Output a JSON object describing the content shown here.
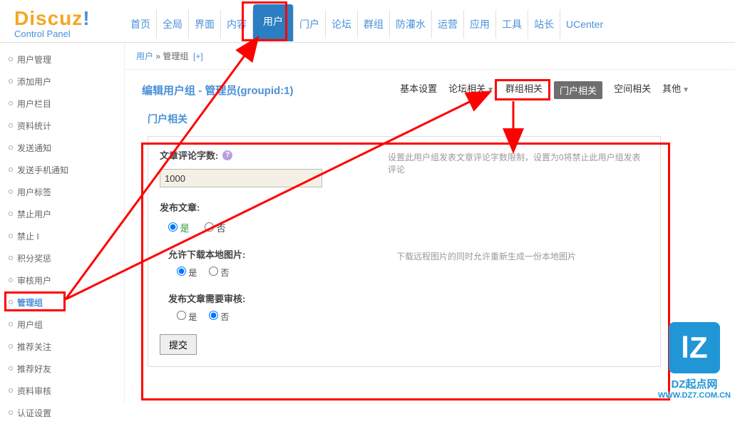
{
  "logo": {
    "main": "Discuz",
    "excl": "!",
    "sub": "Control Panel"
  },
  "topnav": [
    "首页",
    "全局",
    "界面",
    "内容",
    "用户",
    "门户",
    "论坛",
    "群组",
    "防灌水",
    "运营",
    "应用",
    "工具",
    "站长",
    "UCenter"
  ],
  "topnav_active": 4,
  "breadcrumb": {
    "a": "用户",
    "sep": " » ",
    "b": "管理组",
    "plus": "[+]"
  },
  "sidebar": {
    "items": [
      "用户管理",
      "添加用户",
      "用户栏目",
      "资料统计",
      "发送通知",
      "发送手机通知",
      "用户标签",
      "禁止用户",
      "禁止 I",
      "积分奖惩",
      "审核用户",
      "管理组",
      "用户组",
      "推荐关注",
      "推荐好友",
      "资料审核",
      "认证设置"
    ],
    "active": 11
  },
  "page_title": "编辑用户组 - 管理员(groupid:1)",
  "tabs": [
    {
      "label": "基本设置",
      "dd": false
    },
    {
      "label": "论坛相关",
      "dd": true
    },
    {
      "label": "群组相关",
      "dd": false
    },
    {
      "label": "门户相关",
      "dd": false,
      "active": true
    },
    {
      "label": "空间相关",
      "dd": false
    },
    {
      "label": "其他",
      "dd": true
    }
  ],
  "section_title": "门户相关",
  "form": {
    "f1": {
      "label": "文章评论字数:",
      "value": "1000",
      "desc": "设置此用户组发表文章评论字数限制，设置为0将禁止此用户组发表评论"
    },
    "f2": {
      "label": "发布文章:",
      "yes": "是",
      "no": "否",
      "sel": "yes"
    },
    "f3": {
      "label": "允许下载本地图片:",
      "yes": "是",
      "no": "否",
      "sel": "yes",
      "desc": "下载远程图片的同时允许重新生成一份本地图片"
    },
    "f4": {
      "label": "发布文章需要审核:",
      "yes": "是",
      "no": "否",
      "sel": "no"
    },
    "submit": "提交"
  },
  "watermark": {
    "logo": "lZ",
    "text": "DZ起点网",
    "url": "WWW.DZ7.COM.CN"
  }
}
